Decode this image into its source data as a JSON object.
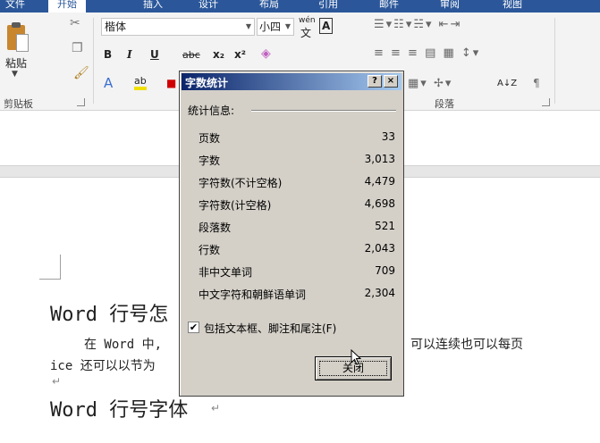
{
  "ribbon": {
    "tabs": [
      "文件",
      "开始",
      "插入",
      "设计",
      "布局",
      "引用",
      "邮件",
      "审阅",
      "视图"
    ],
    "clipboard": {
      "paste_label": "粘贴",
      "group_label": "剪贴板"
    },
    "font": {
      "name": "楷体",
      "size": "小四",
      "pinyin_label": "wén",
      "bold": "B",
      "italic": "I",
      "underline": "U",
      "strike": "abc",
      "subscript": "x₂",
      "superscript": "x²",
      "highlight_label": "ab",
      "font_color_label": "A",
      "boxed_char": "A",
      "phonetic_char": "文"
    },
    "paragraph": {
      "group_label": "段落",
      "sort_label": "A↓Z"
    }
  },
  "dialog": {
    "title": "字数统计",
    "help_button": "?",
    "close_x": "×",
    "group_label": "统计信息:",
    "stats": [
      {
        "label": "页数",
        "value": "33"
      },
      {
        "label": "字数",
        "value": "3,013"
      },
      {
        "label": "字符数(不计空格)",
        "value": "4,479"
      },
      {
        "label": "字符数(计空格)",
        "value": "4,698"
      },
      {
        "label": "段落数",
        "value": "521"
      },
      {
        "label": "行数",
        "value": "2,043"
      },
      {
        "label": "非中文单词",
        "value": "709"
      },
      {
        "label": "中文字符和朝鲜语单词",
        "value": "2,304"
      }
    ],
    "checkbox_checked": true,
    "checkbox_mark": "✔",
    "checkbox_label": "包括文本框、脚注和尾注(F)",
    "close_label": "关闭"
  },
  "document": {
    "heading1": "Word 行号怎",
    "body_line1_left": "在 Word 中,",
    "body_line1_right": "可以连续也可以每页",
    "body_line2": "ice 还可以以节为",
    "para_mark": "↵",
    "heading2": "Word 行号字体",
    "heading2_mark": "↵"
  },
  "colors": {
    "ribbon_tab": "#2b579a",
    "dialog_title_start": "#0a246a",
    "dialog_title_end": "#a6caf0",
    "dialog_face": "#d4d0c8"
  }
}
